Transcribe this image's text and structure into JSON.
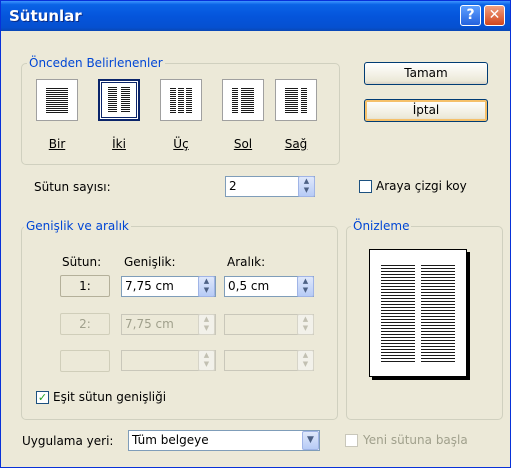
{
  "window": {
    "title": "Sütunlar",
    "help_icon": "?",
    "close_icon": "✕"
  },
  "presets": {
    "label": "Önceden Belirlenenler",
    "items": [
      {
        "label": "Bir",
        "icon": "one-column-icon",
        "selected": false
      },
      {
        "label": "İki",
        "icon": "two-column-icon",
        "selected": true
      },
      {
        "label": "Üç",
        "icon": "three-column-icon",
        "selected": false
      },
      {
        "label": "Sol",
        "icon": "left-column-icon",
        "selected": false
      },
      {
        "label": "Sağ",
        "icon": "right-column-icon",
        "selected": false
      }
    ]
  },
  "buttons": {
    "ok": "Tamam",
    "cancel": "İptal"
  },
  "column_count": {
    "label": "Sütun sayısı:",
    "value": "2"
  },
  "line_between": {
    "label": "Araya çizgi koy",
    "checked": false
  },
  "width_spacing": {
    "label": "Genişlik ve aralık",
    "headers": {
      "column": "Sütun:",
      "width": "Genişlik:",
      "spacing": "Aralık:"
    },
    "rows": [
      {
        "col": "1:",
        "width": "7,75 cm",
        "spacing": "0,5 cm",
        "enabled": true
      },
      {
        "col": "2:",
        "width": "7,75 cm",
        "spacing": "",
        "enabled": false
      },
      {
        "col": "",
        "width": "",
        "spacing": "",
        "enabled": false
      }
    ],
    "equal_width": {
      "label": "Eşit sütun genişliği",
      "checked": true
    }
  },
  "preview": {
    "label": "Önizleme",
    "columns": 2
  },
  "apply_to": {
    "label": "Uygulama yeri:",
    "value": "Tüm belgeye"
  },
  "new_column": {
    "label": "Yeni sütuna başla",
    "checked": false,
    "enabled": false
  },
  "colors": {
    "title_bar": "#0555dc",
    "group_label": "#0046d5",
    "dialog_bg": "#ece9d8",
    "check_mark": "#21a121"
  }
}
